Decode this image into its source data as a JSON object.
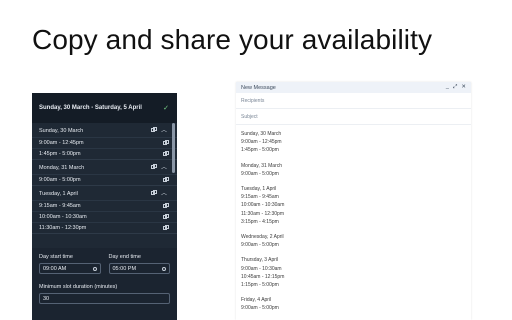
{
  "headline": "Copy and share your availability",
  "panel": {
    "date_range": "Sunday, 30 March - Saturday, 5 April",
    "days": [
      {
        "label": "Sunday, 30 March",
        "slots": [
          "9:00am - 12:45pm",
          "1:45pm - 5:00pm"
        ]
      },
      {
        "label": "Monday, 31 March",
        "slots": [
          "9:00am - 5:00pm"
        ]
      },
      {
        "label": "Tuesday, 1 April",
        "slots": [
          "9:15am - 9:45am",
          "10:00am - 10:30am",
          "11:30am - 12:30pm"
        ]
      }
    ],
    "day_start_label": "Day start time",
    "day_start_value": "09:00 AM",
    "day_end_label": "Day end time",
    "day_end_value": "05:00 PM",
    "min_duration_label": "Minimum slot duration (minutes)",
    "min_duration_value": "30"
  },
  "compose": {
    "title": "New Message",
    "recipients_placeholder": "Recipients",
    "subject_placeholder": "Subject",
    "body_groups": [
      {
        "day": "Sunday, 30 March",
        "slots": [
          "9:00am - 12:45pm",
          "1:45pm - 5:00pm"
        ]
      },
      {
        "day": "Monday, 31 March",
        "slots": [
          "9:00am - 5:00pm"
        ]
      },
      {
        "day": "Tuesday, 1 April",
        "slots": [
          "9:15am - 9:45am",
          "10:00am - 10:30am",
          "11:30am - 12:30pm",
          "3:15pm - 4:15pm"
        ]
      },
      {
        "day": "Wednesday, 2 April",
        "slots": [
          "9:00am - 5:00pm"
        ]
      },
      {
        "day": "Thursday, 3 April",
        "slots": [
          "9:00am - 10:30am",
          "10:45am - 12:15pm",
          "1:15pm - 5:00pm"
        ]
      },
      {
        "day": "Friday, 4 April",
        "slots": [
          "9:00am - 5:00pm"
        ]
      }
    ]
  },
  "colors": {
    "panel_bg": "#1f2935",
    "panel_header_bg": "#141c26",
    "check": "#7bd389",
    "compose_title_bg": "#eef2f8"
  },
  "icons": [
    "check-icon",
    "copy-icon",
    "chevron-up-icon",
    "clock-icon",
    "minimize-icon",
    "expand-icon",
    "close-icon"
  ]
}
